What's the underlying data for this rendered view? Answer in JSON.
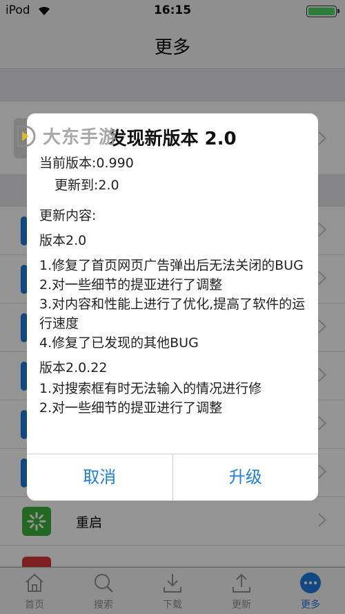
{
  "status_bar": {
    "carrier": "iPod",
    "time": "16:15"
  },
  "nav": {
    "title": "更多"
  },
  "list": {
    "visible_rows": [
      {
        "label": "重启",
        "icon": "restart-icon",
        "color": "#3bb13b"
      }
    ]
  },
  "tabbar": {
    "tabs": [
      {
        "label": "首页",
        "icon": "home-icon"
      },
      {
        "label": "搜索",
        "icon": "search-icon"
      },
      {
        "label": "下载",
        "icon": "download-icon"
      },
      {
        "label": "更新",
        "icon": "update-icon"
      },
      {
        "label": "更多",
        "icon": "more-icon",
        "active": true
      }
    ]
  },
  "dialog": {
    "title": "发现新版本 2.0",
    "current_version": "当前版本:0.990",
    "update_to": "更新到:2.0",
    "content_heading": "更新内容:",
    "sections": [
      {
        "version": "版本2.0",
        "items": [
          "1.修复了首页网页广告弹出后无法关闭的BUG",
          "2.对一些细节的提亚进行了调整",
          "3.对内容和性能上进行了优化,提高了软件的运行速度",
          "4.修复了已发现的其他BUG"
        ]
      },
      {
        "version": "版本2.0.22",
        "items": [
          "1.对搜索框有时无法输入的情况进行修",
          "2.对一些细节的提亚进行了调整"
        ]
      }
    ],
    "cancel_label": "取消",
    "upgrade_label": "升级"
  },
  "watermark": {
    "text": "大东手游"
  },
  "colors": {
    "accent": "#1e7de0",
    "battery": "#4cd964"
  }
}
